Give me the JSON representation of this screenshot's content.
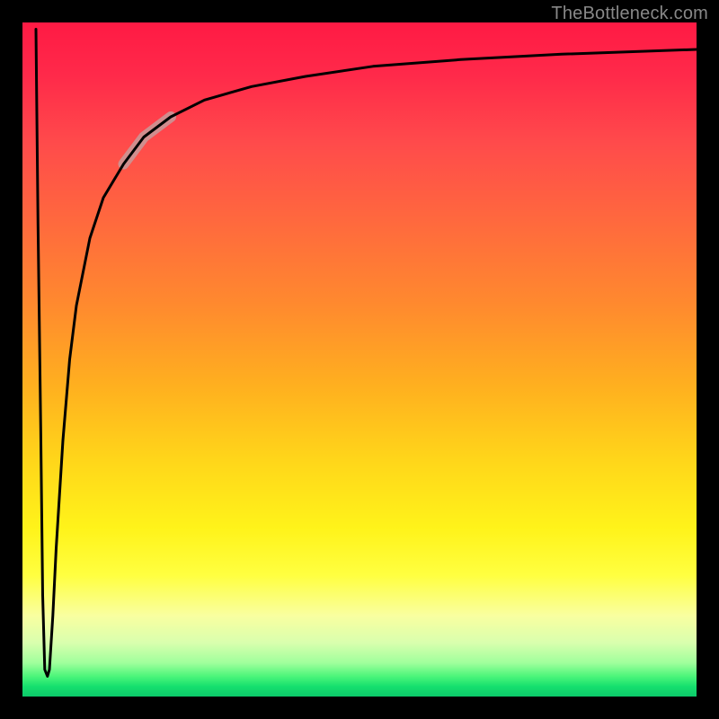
{
  "watermark": "TheBottleneck.com",
  "chart_data": {
    "type": "line",
    "title": "",
    "xlabel": "",
    "ylabel": "",
    "xlim": [
      0,
      100
    ],
    "ylim": [
      0,
      100
    ],
    "grid": false,
    "legend": false,
    "annotations": [],
    "background_gradient_stops": [
      {
        "pos": 0.0,
        "color": "#ff1a44"
      },
      {
        "pos": 0.18,
        "color": "#ff4b4b"
      },
      {
        "pos": 0.42,
        "color": "#ff8a2e"
      },
      {
        "pos": 0.65,
        "color": "#ffd61a"
      },
      {
        "pos": 0.82,
        "color": "#ffff40"
      },
      {
        "pos": 0.92,
        "color": "#d9ffae"
      },
      {
        "pos": 1.0,
        "color": "#0cc96a"
      }
    ],
    "series": [
      {
        "name": "bottleneck-curve",
        "stroke": "#000000",
        "stroke_width": 3,
        "x": [
          2.0,
          2.3,
          2.7,
          3.0,
          3.3,
          3.7,
          4.0,
          4.5,
          5.0,
          6.0,
          7.0,
          8.0,
          10.0,
          12.0,
          15.0,
          18.0,
          22.0,
          27.0,
          34.0,
          42.0,
          52.0,
          65.0,
          80.0,
          100.0
        ],
        "y": [
          99.0,
          70.0,
          40.0,
          15.0,
          4.0,
          3.0,
          4.0,
          12.0,
          22.0,
          38.0,
          50.0,
          58.0,
          68.0,
          74.0,
          79.0,
          83.0,
          86.0,
          88.5,
          90.5,
          92.0,
          93.5,
          94.5,
          95.3,
          96.0
        ]
      },
      {
        "name": "highlight-segment",
        "stroke": "#c89a9a",
        "stroke_width": 12,
        "opacity": 0.85,
        "x": [
          15.0,
          18.0,
          22.0
        ],
        "y": [
          79.0,
          83.0,
          86.0
        ]
      }
    ]
  }
}
